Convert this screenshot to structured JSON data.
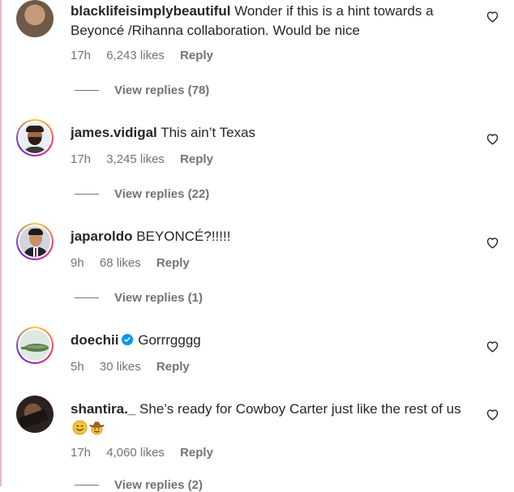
{
  "comments": [
    {
      "username": "blacklifeisimplybeautiful",
      "text": "Wonder if this is a hint towards a Beyoncé /Rihanna collaboration. Would be nice",
      "time": "17h",
      "likes": "6,243 likes",
      "reply": "Reply",
      "view_replies": "View replies (78)"
    },
    {
      "username": "james.vidigal",
      "text": "This ain’t Texas",
      "time": "17h",
      "likes": "3,245 likes",
      "reply": "Reply",
      "view_replies": "View replies (22)"
    },
    {
      "username": "japaroldo",
      "text": "BEYONCÉ?!!!!!",
      "time": "9h",
      "likes": "68 likes",
      "reply": "Reply",
      "view_replies": "View replies (1)"
    },
    {
      "username": "doechii",
      "verified": true,
      "text": "Gorrrgggg",
      "time": "5h",
      "likes": "30 likes",
      "reply": "Reply"
    },
    {
      "username": "shantira._",
      "text": "She’s ready for Cowboy Carter just like the rest of us",
      "emojis": [
        "smiling-face-icon",
        "cowboy-face-icon"
      ],
      "time": "17h",
      "likes": "4,060 likes",
      "reply": "Reply",
      "view_replies": "View replies (2)"
    }
  ],
  "colors": {
    "text": "#262626",
    "muted": "#737373",
    "verified": "#0095f6"
  }
}
